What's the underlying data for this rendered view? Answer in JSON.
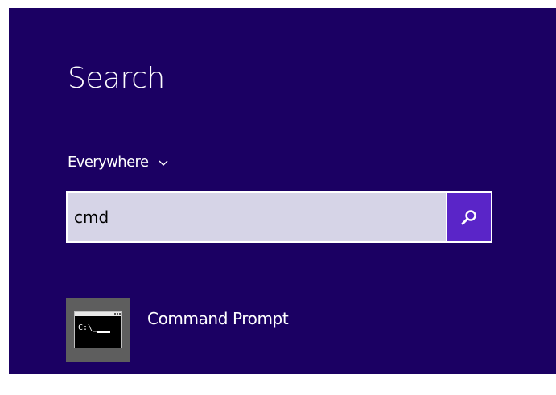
{
  "search_pane": {
    "title": "Search",
    "scope_label": "Everywhere",
    "scope_icon": "chevron-down-icon",
    "query_value": "cmd",
    "search_button_icon": "magnifier-icon"
  },
  "results": [
    {
      "label": "Command Prompt",
      "icon": "command-prompt-icon",
      "icon_glyph": "C:\\_"
    }
  ],
  "colors": {
    "pane_background": "#1b0063",
    "field_background": "#d6d4e7",
    "search_button": "#5a25c8",
    "tile_background": "#5e5e5e",
    "text": "#ffffff"
  }
}
